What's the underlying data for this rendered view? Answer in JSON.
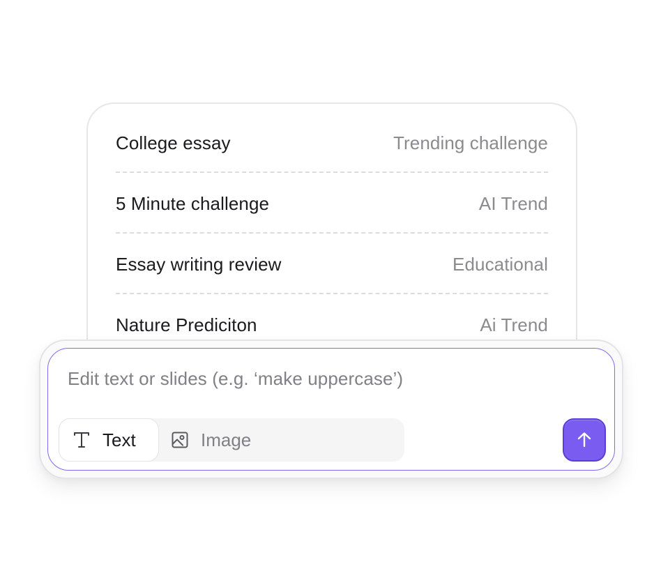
{
  "list": {
    "items": [
      {
        "title": "College essay",
        "tag": "Trending challenge"
      },
      {
        "title": "5 Minute challenge",
        "tag": "AI Trend"
      },
      {
        "title": "Essay writing review",
        "tag": "Educational"
      },
      {
        "title": "Nature Prediciton",
        "tag": "Ai Trend"
      }
    ]
  },
  "prompt": {
    "placeholder": "Edit text or slides (e.g. ‘make uppercase’)",
    "modes": [
      {
        "label": "Text",
        "icon": "text-type-icon",
        "selected": true
      },
      {
        "label": "Image",
        "icon": "image-icon",
        "selected": false
      }
    ],
    "send_icon": "arrow-up-icon"
  },
  "colors": {
    "accent": "#7b5cf0",
    "accent_border": "#7c6cf5",
    "text_primary": "#1a1a1f",
    "text_muted": "#8a8a8f"
  }
}
